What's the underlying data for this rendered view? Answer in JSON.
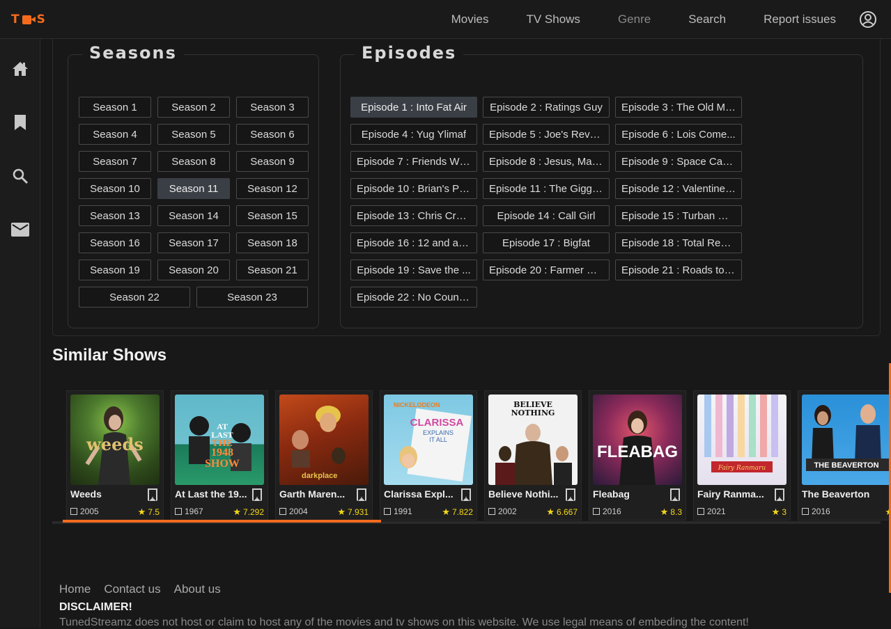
{
  "logo": {
    "left": "T",
    "right": "S"
  },
  "nav": {
    "movies": "Movies",
    "tv_shows": "TV Shows",
    "genre": "Genre",
    "search": "Search",
    "report": "Report issues"
  },
  "seasons": {
    "title": "Seasons",
    "items": [
      "Season 1",
      "Season 2",
      "Season 3",
      "Season 4",
      "Season 5",
      "Season 6",
      "Season 7",
      "Season 8",
      "Season 9",
      "Season 10",
      "Season 11",
      "Season 12",
      "Season 13",
      "Season 14",
      "Season 15",
      "Season 16",
      "Season 17",
      "Season 18",
      "Season 19",
      "Season 20",
      "Season 21",
      "Season 22",
      "Season 23"
    ],
    "active": "Season 11"
  },
  "episodes": {
    "title": "Episodes",
    "items": [
      "Episode 1 : Into Fat Air",
      "Episode 2 : Ratings Guy",
      "Episode 3 : The Old Ma...",
      "Episode 4 : Yug Ylimaf",
      "Episode 5 : Joe's Reve...",
      "Episode 6 : Lois Come...",
      "Episode 7 : Friends Wit...",
      "Episode 8 : Jesus, Mar...",
      "Episode 9 : Space Cad...",
      "Episode 10 : Brian's Play",
      "Episode 11 : The Giggit...",
      "Episode 12 : Valentine'...",
      "Episode 13 : Chris Cross",
      "Episode 14 : Call Girl",
      "Episode 15 : Turban Co...",
      "Episode 16 : 12 and a H...",
      "Episode 17 : Bigfat",
      "Episode 18 : Total Recall",
      "Episode 19 : Save the ...",
      "Episode 20 : Farmer G...",
      "Episode 21 : Roads to V...",
      "Episode 22 : No Countr..."
    ],
    "active": "Episode 1 : Into Fat Air"
  },
  "similar": {
    "title": "Similar Shows",
    "cards": [
      {
        "title": "Weeds",
        "year": "2005",
        "rating": "7.5"
      },
      {
        "title": "At Last the 19...",
        "year": "1967",
        "rating": "7.292"
      },
      {
        "title": "Garth Maren...",
        "year": "2004",
        "rating": "7.931"
      },
      {
        "title": "Clarissa Expl...",
        "year": "1991",
        "rating": "7.822"
      },
      {
        "title": "Believe Nothi...",
        "year": "2002",
        "rating": "6.667"
      },
      {
        "title": "Fleabag",
        "year": "2016",
        "rating": "8.3"
      },
      {
        "title": "Fairy Ranma...",
        "year": "2021",
        "rating": "3"
      },
      {
        "title": "The Beaverton",
        "year": "2016",
        "rating": ""
      }
    ],
    "poster_text": {
      "weeds": "weeds",
      "lastshow_1": "AT",
      "lastshow_2": "LAST",
      "lastshow_3": "THE",
      "lastshow_4": "1948",
      "lastshow_5": "SHOW",
      "darkplace": "darkplace",
      "clarissa_brand": "NICKELODEON",
      "clarissa_1": "CLARISSA",
      "clarissa_2": "EXPLAINS",
      "clarissa_3": "IT ALL",
      "believe_1": "BELIEVE",
      "believe_2": "NOTHING",
      "fleabag": "FLEABAG",
      "fairy": "Fairy Ranmaru",
      "beaverton": "THE BEAVERTON"
    }
  },
  "footer": {
    "links": [
      "Home",
      "Contact us",
      "About us"
    ],
    "disclaimer_title": "DISCLAIMER!",
    "disclaimer": "TunedStreamz does not host or claim to host any of the movies and tv shows on this website. We use legal means of embeding the content!"
  },
  "colors": {
    "accent": "#f26b1d",
    "background": "#181818",
    "rating": "#f5d81a"
  }
}
